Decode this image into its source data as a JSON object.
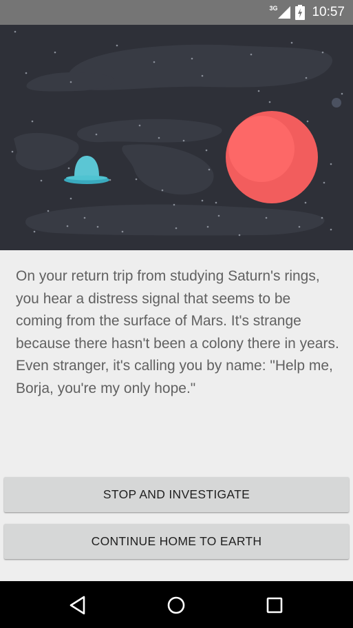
{
  "status_bar": {
    "network": "3G",
    "time": "10:57",
    "icons": [
      "signal-icon",
      "battery-icon"
    ]
  },
  "hero": {
    "description_icons": [
      "ufo-icon",
      "mars-planet-icon",
      "moon-icon"
    ],
    "colors": {
      "sky": "#2e3038",
      "planet": "#f25d5d",
      "ufo": "#4fc3d1"
    }
  },
  "story": {
    "text": "On your return trip from studying Saturn's rings, you hear a distress signal that seems to be coming from the surface of Mars. It's strange because there hasn't been a colony there in years. Even stranger, it's calling you by name: \"Help me, Borja, you're my only hope.\""
  },
  "choices": {
    "choice1_label": "STOP AND INVESTIGATE",
    "choice2_label": "CONTINUE HOME TO EARTH"
  },
  "nav_bar": {
    "icons": [
      "back-icon",
      "home-icon",
      "recents-icon"
    ]
  }
}
